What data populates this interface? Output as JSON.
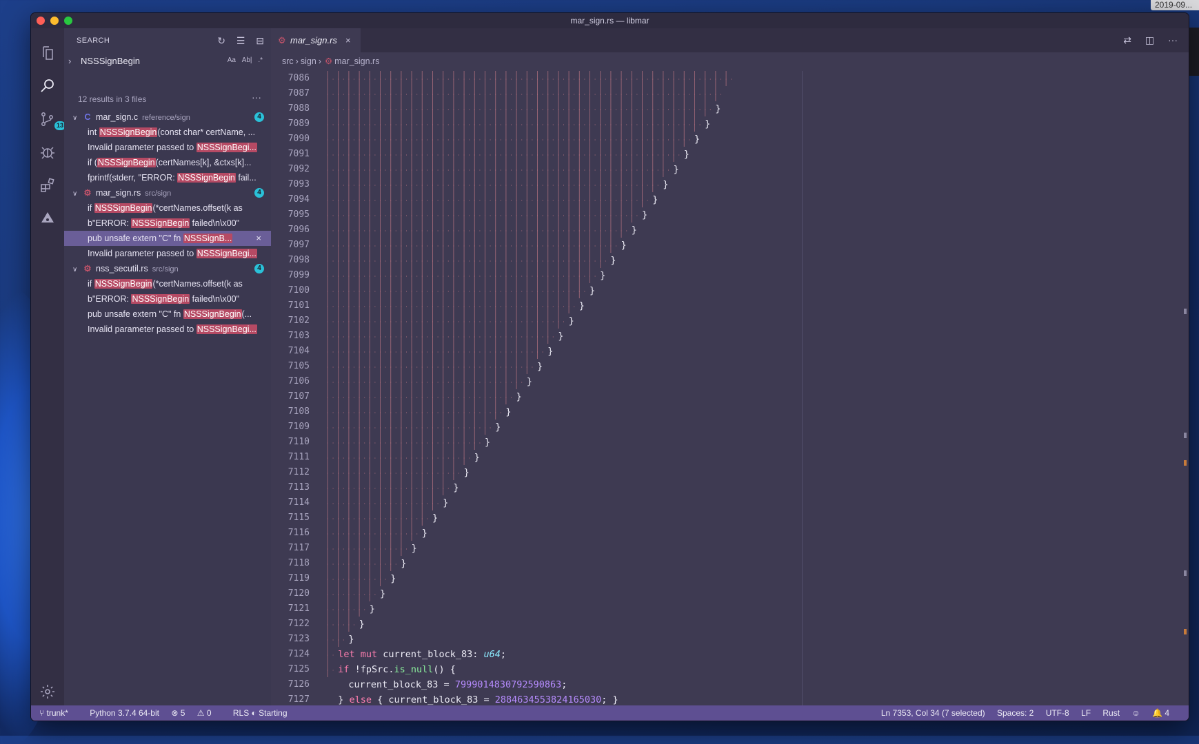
{
  "desktop": {
    "date": "2019-09..."
  },
  "window": {
    "title": "mar_sign.rs — libmar"
  },
  "activity": {
    "scm_badge": "13"
  },
  "sidebar": {
    "header": "SEARCH",
    "actions": {
      "refresh": "↻",
      "clear": "☰",
      "collapse": "⊟"
    },
    "search_value": "NSSSignBegin",
    "options": {
      "match_case": "Aa",
      "whole_word": "Ab|",
      "regex": ".*"
    },
    "results_count": "12 results in 3 files",
    "files": [
      {
        "name": "mar_sign.c",
        "path": "reference/sign",
        "count": "4",
        "icon": "C",
        "matches": [
          {
            "pre": "int ",
            "hl": "NSSSignBegin",
            "post": "(const char* certName, ..."
          },
          {
            "pre": "Invalid parameter passed to ",
            "hl": "NSSSignBegi...",
            "post": ""
          },
          {
            "pre": "if (",
            "hl": "NSSSignBegin",
            "post": "(certNames[k], &ctxs[k]..."
          },
          {
            "pre": "fprintf(stderr, \"ERROR: ",
            "hl": "NSSSignBegin",
            "post": " fail..."
          }
        ]
      },
      {
        "name": "mar_sign.rs",
        "path": "src/sign",
        "count": "4",
        "icon": "R",
        "matches": [
          {
            "pre": "if ",
            "hl": "NSSSignBegin",
            "post": "(*certNames.offset(k as"
          },
          {
            "pre": "b\"ERROR: ",
            "hl": "NSSSignBegin",
            "post": " failed\\n\\x00\""
          },
          {
            "pre": "pub unsafe extern \"C\" fn ",
            "hl": "NSSSignB...",
            "post": ""
          },
          {
            "pre": "Invalid parameter passed to ",
            "hl": "NSSSignBegi...",
            "post": ""
          }
        ]
      },
      {
        "name": "nss_secutil.rs",
        "path": "src/sign",
        "count": "4",
        "icon": "R",
        "matches": [
          {
            "pre": "if ",
            "hl": "NSSSignBegin",
            "post": "(*certNames.offset(k as"
          },
          {
            "pre": "b\"ERROR: ",
            "hl": "NSSSignBegin",
            "post": " failed\\n\\x00\""
          },
          {
            "pre": "pub unsafe extern \"C\" fn ",
            "hl": "NSSSignBegin",
            "post": "(..."
          },
          {
            "pre": "Invalid parameter passed to ",
            "hl": "NSSSignBegi...",
            "post": ""
          }
        ]
      }
    ],
    "dismiss": "×"
  },
  "editor": {
    "tab": {
      "label": "mar_sign.rs",
      "close": "×"
    },
    "tab_actions": {
      "compare": "⇄",
      "split": "◫",
      "more": "···"
    },
    "breadcrumb": [
      "src",
      "sign",
      "mar_sign.rs"
    ],
    "brace_lines": {
      "first": 7086,
      "last": 7123
    },
    "code": [
      {
        "line": "7124",
        "tokens": [
          {
            "c": "kw",
            "t": "let "
          },
          {
            "c": "kw",
            "t": "mut "
          },
          {
            "c": "",
            "t": "current_block_83: "
          },
          {
            "c": "ty",
            "t": "u64"
          },
          {
            "c": "",
            "t": ";"
          }
        ]
      },
      {
        "line": "7125",
        "tokens": [
          {
            "c": "kw",
            "t": "if "
          },
          {
            "c": "",
            "t": "!fpSrc."
          },
          {
            "c": "fn",
            "t": "is_null"
          },
          {
            "c": "",
            "t": "() {"
          }
        ]
      },
      {
        "line": "7126",
        "tokens": [
          {
            "c": "",
            "t": "current_block_83 = "
          },
          {
            "c": "num",
            "t": "7999014830792590863"
          },
          {
            "c": "",
            "t": ";"
          }
        ]
      },
      {
        "line": "7127",
        "tokens": [
          {
            "c": "",
            "t": "} "
          },
          {
            "c": "kw",
            "t": "else "
          },
          {
            "c": "",
            "t": "{ current_block_83 = "
          },
          {
            "c": "num",
            "t": "2884634553824165030"
          },
          {
            "c": "",
            "t": "; }"
          }
        ]
      }
    ]
  },
  "status": {
    "branch": "trunk*",
    "python": "Python 3.7.4 64-bit",
    "errors": "5",
    "warnings": "0",
    "rls": "RLS ◐ Starting",
    "position": "Ln 7353, Col 34 (7 selected)",
    "spaces": "Spaces: 2",
    "encoding": "UTF-8",
    "eol": "LF",
    "language": "Rust",
    "feedback": "☺",
    "notifications": "4"
  },
  "colors": {
    "accent": "#2ac1d8",
    "highlight": "#b64a64",
    "statusbar": "#5e4f92",
    "guide": "#b0707e"
  }
}
